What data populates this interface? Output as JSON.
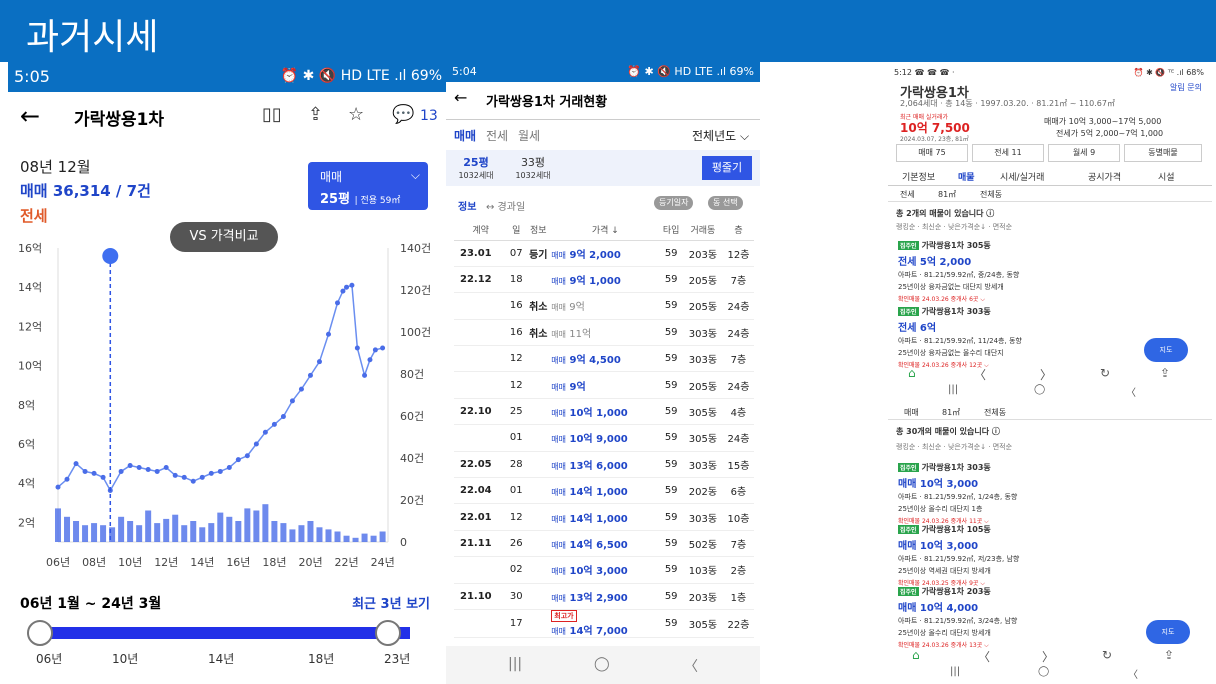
{
  "slide": {
    "title": "과거시세"
  },
  "phone1": {
    "status_time": "5:05",
    "status_right": "⏰ ✱ 🔇 HD LTE .ıl 69%",
    "back": "←",
    "title": "가락쌍용1차",
    "map_icon": "▯▯",
    "share_icon": "⇪",
    "star_icon": "☆",
    "chat_count": "13",
    "date": "08년 12월",
    "sale": "매매 36,314 / 7건",
    "jeonse": "전세",
    "select_type": "매매",
    "select_size": "25평",
    "select_area": "전용 59㎡",
    "vs_label": "VS 가격비교",
    "range": "06년 1월 ~ 24년 3월",
    "recent": "최근 3년 보기",
    "slider_labels": [
      "06년",
      "10년",
      "14년",
      "18년",
      "23년"
    ],
    "slider_range": [
      0,
      0.94
    ]
  },
  "chart_data": {
    "type": "line",
    "title": "",
    "x_tick_labels": [
      "06년",
      "08년",
      "10년",
      "12년",
      "14년",
      "16년",
      "18년",
      "20년",
      "22년",
      "24년"
    ],
    "y_left_ticks": [
      "2억",
      "4억",
      "6억",
      "8억",
      "10억",
      "12억",
      "14억",
      "16억"
    ],
    "y_right_ticks": [
      "0",
      "20건",
      "40건",
      "60건",
      "80건",
      "100건",
      "120건",
      "140건"
    ],
    "ylim_left": [
      1,
      16
    ],
    "ylim_right": [
      0,
      140
    ],
    "series": [
      {
        "type": "line",
        "unit": "억",
        "x": [
          2006.0,
          2006.5,
          2007.0,
          2007.5,
          2008.0,
          2008.5,
          2008.9,
          2009.5,
          2010.0,
          2010.5,
          2011.0,
          2011.5,
          2012.0,
          2012.5,
          2013.0,
          2013.5,
          2014.0,
          2014.5,
          2015.0,
          2015.5,
          2016.0,
          2016.5,
          2017.0,
          2017.5,
          2018.0,
          2018.5,
          2019.0,
          2019.5,
          2020.0,
          2020.5,
          2021.0,
          2021.5,
          2021.8,
          2022.0,
          2022.3,
          2022.6,
          2023.0,
          2023.3,
          2023.6,
          2024.0
        ],
        "y": [
          3.8,
          4.2,
          5.0,
          4.6,
          4.5,
          4.3,
          3.63,
          4.6,
          4.9,
          4.8,
          4.7,
          4.6,
          4.8,
          4.4,
          4.3,
          4.1,
          4.3,
          4.5,
          4.6,
          4.8,
          5.2,
          5.4,
          6.0,
          6.6,
          7.0,
          7.4,
          8.2,
          8.8,
          9.5,
          10.2,
          11.6,
          13.2,
          13.8,
          14.0,
          14.1,
          10.9,
          9.5,
          10.3,
          10.8,
          10.9
        ]
      },
      {
        "type": "bar",
        "unit": "건",
        "x": [
          2006.0,
          2006.5,
          2007.0,
          2007.5,
          2008.0,
          2008.5,
          2009.0,
          2009.5,
          2010.0,
          2010.5,
          2011.0,
          2011.5,
          2012.0,
          2012.5,
          2013.0,
          2013.5,
          2014.0,
          2014.5,
          2015.0,
          2015.5,
          2016.0,
          2016.5,
          2017.0,
          2017.5,
          2018.0,
          2018.5,
          2019.0,
          2019.5,
          2020.0,
          2020.5,
          2021.0,
          2021.5,
          2022.0,
          2022.5,
          2023.0,
          2023.5,
          2024.0
        ],
        "y": [
          16,
          12,
          10,
          8,
          9,
          8,
          7,
          12,
          10,
          8,
          15,
          9,
          11,
          13,
          8,
          10,
          7,
          9,
          14,
          12,
          10,
          16,
          15,
          18,
          10,
          9,
          6,
          8,
          10,
          7,
          6,
          5,
          3,
          2,
          4,
          3,
          5
        ]
      }
    ],
    "selected_x": 2008.9,
    "grid": true
  },
  "phone2": {
    "status_time": "5:04",
    "status_right": "⏰ ✱ 🔇 HD LTE .ıl 69%",
    "back": "←",
    "title": "가락쌍용1차 거래현황",
    "tabs": [
      "매매",
      "전세",
      "월세"
    ],
    "year_filter": "전체년도 ⌵",
    "size1": "25평",
    "size1_sub": "1032세대",
    "size2": "33평",
    "size2_sub": "1032세대",
    "btn": "평줄기",
    "info": "정보",
    "info2": "↔ 경과일",
    "pill1": "등기일자",
    "pill2": "동 선택",
    "headers": [
      "계약",
      "일",
      "정보",
      "가격 ↓",
      "타입",
      "거래동",
      "층"
    ],
    "rows": [
      {
        "ym": "23.01",
        "d": "07",
        "info": "등기",
        "k": "매매",
        "price": "9억 2,000",
        "type": "59",
        "dong": "203동",
        "floor": "12층",
        "cancel": false
      },
      {
        "ym": "22.12",
        "d": "18",
        "info": "",
        "k": "매매",
        "price": "9억 1,000",
        "type": "59",
        "dong": "205동",
        "floor": "7층",
        "cancel": false
      },
      {
        "ym": "",
        "d": "16",
        "info": "취소",
        "k": "매매",
        "price": "9억",
        "type": "59",
        "dong": "205동",
        "floor": "24층",
        "cancel": true
      },
      {
        "ym": "",
        "d": "16",
        "info": "취소",
        "k": "매매",
        "price": "11억",
        "type": "59",
        "dong": "303동",
        "floor": "24층",
        "cancel": true
      },
      {
        "ym": "",
        "d": "12",
        "info": "",
        "k": "매매",
        "price": "9억 4,500",
        "type": "59",
        "dong": "303동",
        "floor": "7층",
        "cancel": false
      },
      {
        "ym": "",
        "d": "12",
        "info": "",
        "k": "매매",
        "price": "9억",
        "type": "59",
        "dong": "205동",
        "floor": "24층",
        "cancel": false
      },
      {
        "ym": "22.10",
        "d": "25",
        "info": "",
        "k": "매매",
        "price": "10억 1,000",
        "type": "59",
        "dong": "305동",
        "floor": "4층",
        "cancel": false
      },
      {
        "ym": "",
        "d": "01",
        "info": "",
        "k": "매매",
        "price": "10억 9,000",
        "type": "59",
        "dong": "305동",
        "floor": "24층",
        "cancel": false
      },
      {
        "ym": "22.05",
        "d": "28",
        "info": "",
        "k": "매매",
        "price": "13억 6,000",
        "type": "59",
        "dong": "303동",
        "floor": "15층",
        "cancel": false
      },
      {
        "ym": "22.04",
        "d": "01",
        "info": "",
        "k": "매매",
        "price": "14억 1,000",
        "type": "59",
        "dong": "202동",
        "floor": "6층",
        "cancel": false
      },
      {
        "ym": "22.01",
        "d": "12",
        "info": "",
        "k": "매매",
        "price": "14억 1,000",
        "type": "59",
        "dong": "303동",
        "floor": "10층",
        "cancel": false
      },
      {
        "ym": "21.11",
        "d": "26",
        "info": "",
        "k": "매매",
        "price": "14억 6,500",
        "type": "59",
        "dong": "502동",
        "floor": "7층",
        "cancel": false
      },
      {
        "ym": "",
        "d": "02",
        "info": "",
        "k": "매매",
        "price": "10억 3,000",
        "type": "59",
        "dong": "103동",
        "floor": "2층",
        "cancel": false
      },
      {
        "ym": "21.10",
        "d": "30",
        "info": "",
        "k": "매매",
        "price": "13억 2,900",
        "type": "59",
        "dong": "203동",
        "floor": "1층",
        "cancel": false
      },
      {
        "ym": "",
        "d": "17",
        "info": "",
        "k": "매매",
        "price": "14억 7,000",
        "type": "59",
        "dong": "305동",
        "floor": "22층",
        "cancel": false,
        "badge": "최고가"
      }
    ],
    "nav": [
      "|||",
      "◯",
      "〈"
    ]
  },
  "phone3": {
    "status": "5:12 ☎ ☎ ☎ ·",
    "status_right": "⏰ ✱ 🔇 ᵀᴱ .ıl 68%",
    "title": "가락쌍용1차",
    "links": "알림  문의",
    "summary": "2,064세대 · 총 14동 · 1997.03.20. · 81.21㎡ ~ 110.67㎡",
    "recent_label": "최근 매매 실거래가",
    "recent_price": "10억 7,500",
    "recent_date": "2024.03.07, 23층, 81㎡",
    "sale_range": "매매가 10억 3,000~17억 5,000",
    "jeonse_range": "전세가 5억 2,000~7억 1,000",
    "chips": [
      "매매 75",
      "전세 11",
      "월세 9",
      "동별매물"
    ],
    "tabs": [
      "기본정보",
      "매물",
      "시세/실거래",
      "공시가격",
      "시설"
    ],
    "subtabs": [
      "전세",
      "81㎡",
      "전체동"
    ],
    "count1": "총 2개의 매물이 있습니다 ⓘ",
    "sort": "랭킹순 · 최신순 · 낮은가격순↓ · 면적순",
    "cards1": [
      {
        "label": "가락쌍용1차 305동",
        "price": "전세 5억 2,000",
        "d1": "아파트 · 81.21/59.92㎡, 중/24층, 동향",
        "d2": "25년이상  융자금없는  대단지  방세개",
        "d3": "확인매물 24.03.26  중개사 6곳 ⌵"
      },
      {
        "label": "가락쌍용1차 303동",
        "price": "전세 6억",
        "d1": "아파트 · 81.21/59.92㎡, 11/24층, 동향",
        "d2": "25년이상  융자금없는  올수리  대단지",
        "d3": "확인매물 24.03.26  중개사 12곳 ⌵"
      }
    ],
    "subtabs2": [
      "매매",
      "81㎡",
      "전체동"
    ],
    "count2": "총 30개의 매물이 있습니다 ⓘ",
    "cards2": [
      {
        "label": "가락쌍용1차 303동",
        "price": "매매 10억 3,000",
        "d1": "아파트 · 81.21/59.92㎡, 1/24층, 동향",
        "d2": "25년이상  올수리  대단지  1층",
        "d3": "확인매물 24.03.26  중개사 11곳 ⌵"
      },
      {
        "label": "가락쌍용1차 105동",
        "price": "매매 10억 3,000",
        "d1": "아파트 · 81.21/59.92㎡, 저/23층, 남향",
        "d2": "25년이상  역세권  대단지  방세개",
        "d3": "확인매물 24.03.25  중개사 9곳 ⌵"
      },
      {
        "label": "가락쌍용1차 203동",
        "price": "매매 10억 4,000",
        "d1": "아파트 · 81.21/59.92㎡, 3/24층, 남향",
        "d2": "25년이상  올수리  대단지  방세개",
        "d3": "확인매물 24.03.26  중개사 13곳 ⌵"
      }
    ],
    "fab": "지도",
    "navrow": [
      "⌂",
      "〈",
      "〉",
      "↻",
      "⇪"
    ],
    "sysnav": [
      "|||",
      "◯",
      "〈"
    ]
  }
}
